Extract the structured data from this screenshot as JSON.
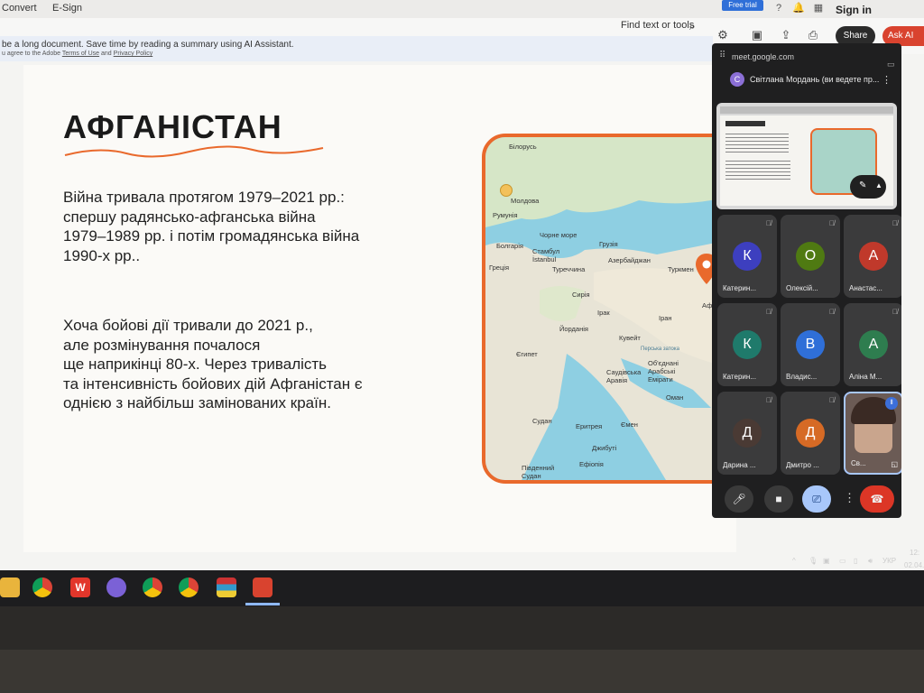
{
  "topbar": {
    "menu1": "Convert",
    "menu2": "E-Sign",
    "free_trial": "Free trial",
    "sign_in": "Sign in"
  },
  "toolbar": {
    "find_text": "Find text or tools",
    "share": "Share",
    "ask_ai": "Ask AI"
  },
  "ai_banner": {
    "line1": "be a long document. Save time by reading a summary using AI Assistant.",
    "line2_prefix": "u agree to the Adobe",
    "terms": "Terms of Use",
    "and": "and",
    "privacy": "Privacy Policy"
  },
  "slide": {
    "title": "АФГАНІСТАН",
    "para1": [
      "Війна тривала протягом 1979–2021 рр.:",
      "спершу радянсько-афганська війна",
      "1979–1989 рр. і потім громадянська війна",
      "1990-х рр.."
    ],
    "para2": [
      "Хоча бойові дії тривали до 2021 р.,",
      "але розмінування почалося",
      "ще наприкінці 80-х. Через тривалість",
      "та інтенсивність бойових дій Афганістан є",
      "однією з найбільш замінованих країн."
    ],
    "map_labels": [
      "Білорусь",
      "Молдова",
      "Румунія",
      "Болгарія",
      "Чорне море",
      "Стамбул",
      "İstanbul",
      "Греція",
      "Туреччина",
      "Грузія",
      "Азербайджан",
      "Туркмен",
      "Сирія",
      "Ірак",
      "Іран",
      "Йорданія",
      "Кувейт",
      "Єгипет",
      "Саудівська Аравія",
      "Об'єднані Арабські Емірати",
      "Оман",
      "Судан",
      "Еритрея",
      "Ємен",
      "Джибуті",
      "Ефіопія",
      "Південний Судан",
      "Афга",
      "Перська затока"
    ]
  },
  "meet": {
    "url": "meet.google.com",
    "presenter_initial": "С",
    "presenter": "Світлана Мордань (ви ведете пр...",
    "tiles": [
      {
        "initial": "К",
        "name": "Катерин...",
        "color": "#3d3fbf"
      },
      {
        "initial": "О",
        "name": "Олексій...",
        "color": "#4f7a12"
      },
      {
        "initial": "А",
        "name": "Анастас...",
        "color": "#c0392b"
      },
      {
        "initial": "К",
        "name": "Катерин...",
        "color": "#1f7a6b"
      },
      {
        "initial": "В",
        "name": "Владис...",
        "color": "#2f6fd8"
      },
      {
        "initial": "А",
        "name": "Аліна М...",
        "color": "#2e7d4f"
      },
      {
        "initial": "Д",
        "name": "Дарина ...",
        "color": "#4a3a34"
      },
      {
        "initial": "Д",
        "name": "Дмитро ...",
        "color": "#d66a25"
      },
      {
        "initial": "",
        "name": "Св...",
        "color": "#6b5b55"
      }
    ]
  },
  "tray": {
    "lang": "УКР",
    "time": "12:",
    "date": "02.04."
  },
  "colors": {
    "accent": "#e9692c",
    "adobe_red": "#d9432f",
    "meet_bg": "#1f1f20"
  }
}
